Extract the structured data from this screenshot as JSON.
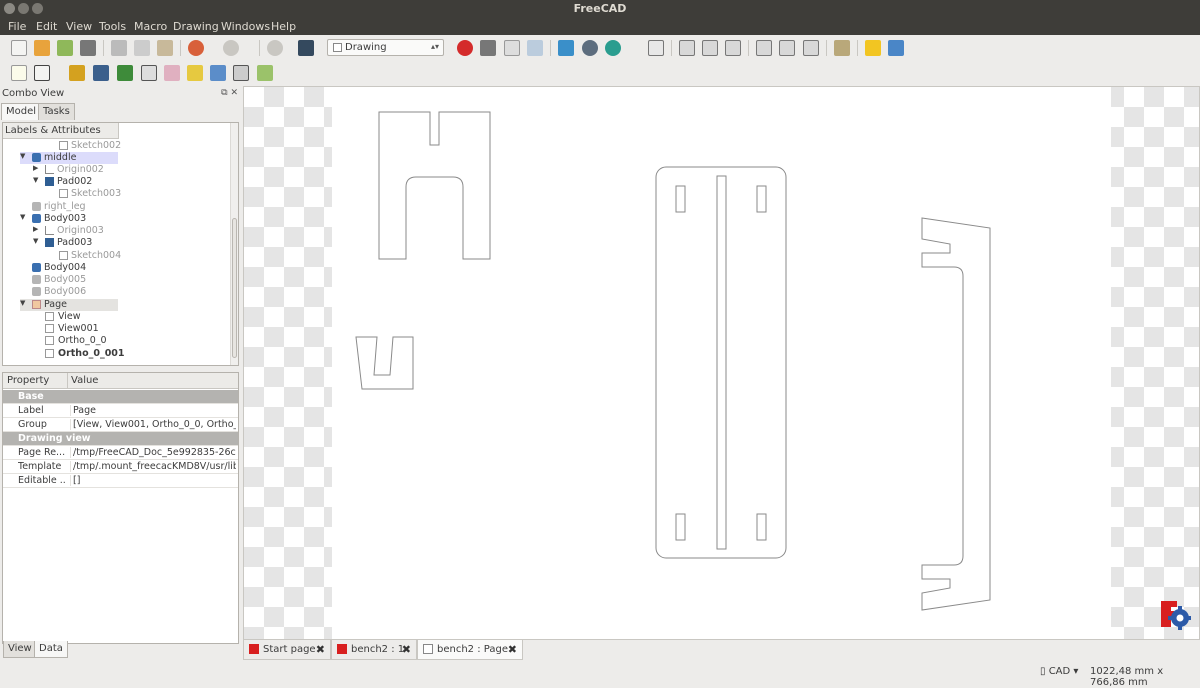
{
  "window": {
    "title": "FreeCAD"
  },
  "menu": [
    "File",
    "Edit",
    "View",
    "Tools",
    "Macro",
    "Drawing",
    "Windows",
    "Help"
  ],
  "toolbar": {
    "workbench": "Drawing",
    "row1_icons": [
      "new-document-icon",
      "open-icon",
      "save-icon",
      "print-icon",
      "cut-icon",
      "copy-icon",
      "paste-icon",
      "undo-icon",
      "redo-icon",
      "refresh-icon",
      "whats-this-icon",
      "record-macro-icon",
      "stop-macro-icon",
      "edit-macro-icon",
      "run-macro-icon",
      "fit-all-icon",
      "fit-selection-icon",
      "draw-style-icon",
      "isometric-view-icon",
      "front-view-icon",
      "top-view-icon",
      "right-view-icon",
      "rear-view-icon",
      "bottom-view-icon",
      "left-view-icon",
      "measure-icon",
      "part-icon",
      "group-icon"
    ],
    "row2_icons": [
      "new-drawing-icon",
      "annotation-icon",
      "insert-view-icon",
      "ortho-views-icon",
      "open-browser-icon",
      "clip-icon",
      "symbol-icon",
      "draft-view-icon",
      "spreadsheet-view-icon",
      "projection-icon",
      "export-page-icon"
    ]
  },
  "combo_view": {
    "title": "Combo View",
    "tabs": [
      "Model",
      "Tasks"
    ],
    "active_tab": "Model",
    "tree_header": "Labels & Attributes",
    "tree": [
      {
        "label": "Sketch002",
        "style": "gray",
        "icon": "sketch-icon"
      },
      {
        "label": "middle",
        "style": "normal",
        "icon": "body-icon",
        "expanded": true,
        "selected": true
      },
      {
        "label": "Origin002",
        "style": "gray",
        "icon": "origin-icon",
        "collapsed": true
      },
      {
        "label": "Pad002",
        "style": "normal",
        "icon": "pad-icon",
        "expanded": true
      },
      {
        "label": "Sketch003",
        "style": "gray",
        "icon": "sketch-icon"
      },
      {
        "label": "right_leg",
        "style": "gray",
        "icon": "body-icon"
      },
      {
        "label": "Body003",
        "style": "normal",
        "icon": "body-icon",
        "expanded": true
      },
      {
        "label": "Origin003",
        "style": "gray",
        "icon": "origin-icon",
        "collapsed": true
      },
      {
        "label": "Pad003",
        "style": "normal",
        "icon": "pad-icon",
        "expanded": true
      },
      {
        "label": "Sketch004",
        "style": "gray",
        "icon": "sketch-icon"
      },
      {
        "label": "Body004",
        "style": "normal",
        "icon": "body-icon"
      },
      {
        "label": "Body005",
        "style": "gray",
        "icon": "body-icon"
      },
      {
        "label": "Body006",
        "style": "gray",
        "icon": "body-icon"
      },
      {
        "label": "Page",
        "style": "normal",
        "icon": "page-icon",
        "expanded": true,
        "selected": true
      },
      {
        "label": "View",
        "style": "normal",
        "icon": "view-icon"
      },
      {
        "label": "View001",
        "style": "normal",
        "icon": "view-icon"
      },
      {
        "label": "Ortho_0_0",
        "style": "normal",
        "icon": "view-icon"
      },
      {
        "label": "Ortho_0_001",
        "style": "bold",
        "icon": "view-icon"
      }
    ]
  },
  "property_view": {
    "headers": [
      "Property",
      "Value"
    ],
    "rows": [
      {
        "group": "Base"
      },
      {
        "name": "Label",
        "value": "Page"
      },
      {
        "name": "Group",
        "value": "[View, View001, Ortho_0_0, Ortho_..."
      },
      {
        "group": "Drawing view"
      },
      {
        "name": "Page Re...",
        "value": "/tmp/FreeCAD_Doc_5e992835-26c..."
      },
      {
        "name": "Template",
        "value": "/tmp/.mount_freecacKMD8V/usr/lib..."
      },
      {
        "name": "Editable ...",
        "value": "[]"
      }
    ],
    "bottom_tabs": [
      "View",
      "Data"
    ],
    "active_bottom_tab": "Data"
  },
  "document_tabs": [
    {
      "label": "Start page",
      "icon": "freecad-icon"
    },
    {
      "label": "bench2 : 1",
      "icon": "freecad-icon"
    },
    {
      "label": "bench2 : Page",
      "icon": "page-icon",
      "active": true
    }
  ],
  "status": {
    "nav_style": "CAD",
    "dimensions": "1022,48 mm x 766,86 mm"
  },
  "colors": {
    "menubar": "#3e3d39",
    "record": "#d42b2b",
    "selection": "#dcdcfb",
    "logo_red": "#d81f1f",
    "logo_blue": "#2c5aa8"
  }
}
